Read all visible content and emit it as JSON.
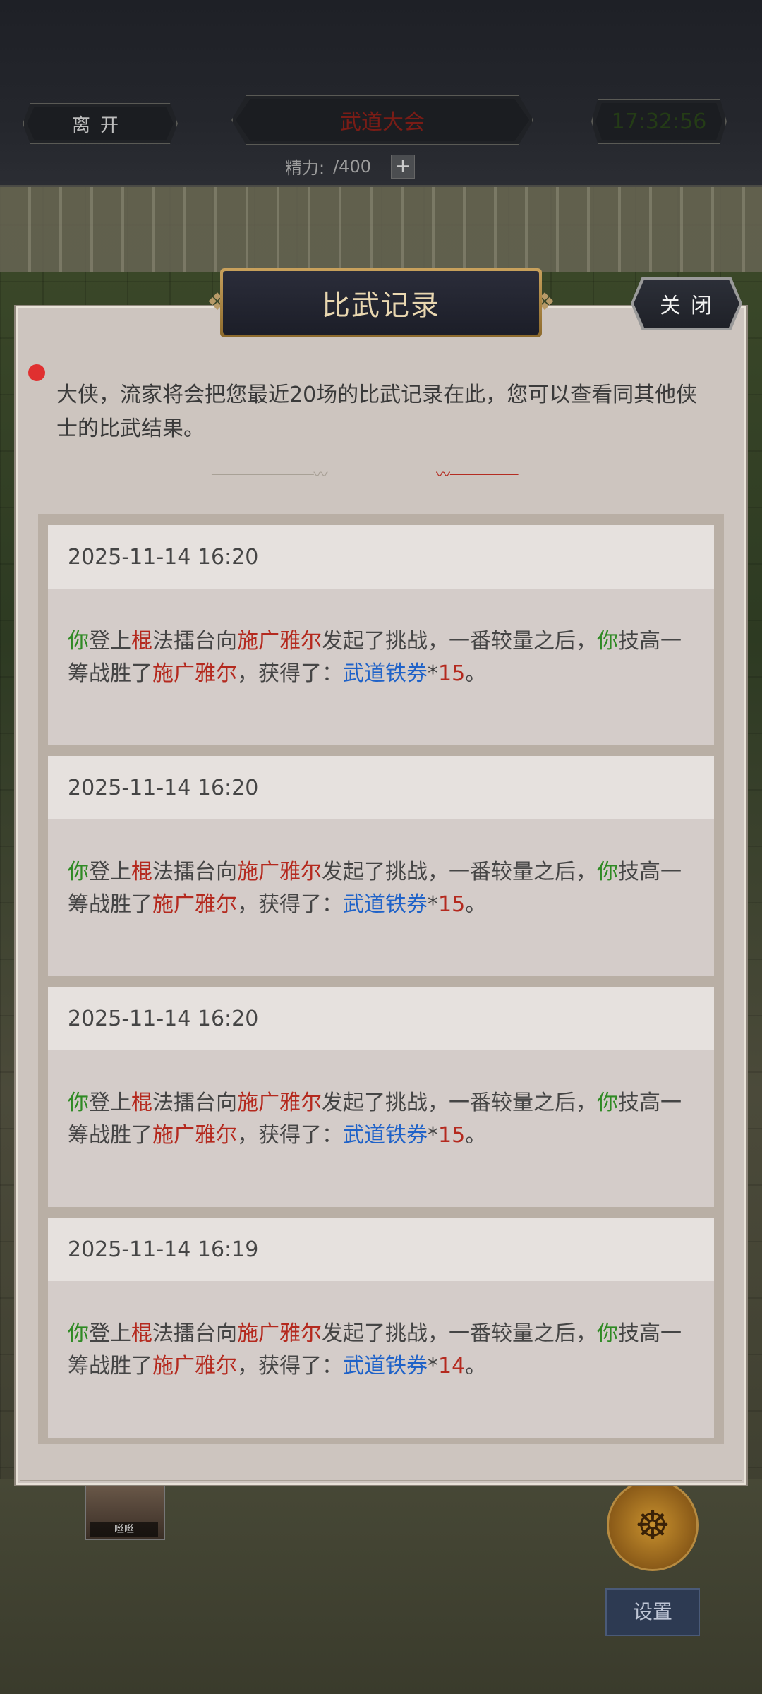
{
  "top_bar": {
    "leave_label": "离开",
    "event_title": "武道大会",
    "clock": "17:32:56",
    "energy_label": "精力:",
    "energy_current": "",
    "energy_max": "/400",
    "energy_add": "+"
  },
  "modal": {
    "title": "比武记录",
    "close_label": "关闭",
    "intro": "大侠，流家将会把您最近20场的比武记录在此，您可以查看同其他侠士的比武结果。",
    "records": [
      {
        "time": "2025-11-14 16:20",
        "you": "你",
        "t1": "登上",
        "weapon": "棍",
        "t2": "法擂台向",
        "opponent": "施广雅尔",
        "t3": "发起了挑战，一番较量之后，",
        "you2": "你",
        "t4": "技高一筹战胜了",
        "opponent2": "施广雅尔",
        "t5": "，获得了：",
        "reward": "武道铁券",
        "star": "*",
        "qty": "15",
        "end": "。"
      },
      {
        "time": "2025-11-14 16:20",
        "you": "你",
        "t1": "登上",
        "weapon": "棍",
        "t2": "法擂台向",
        "opponent": "施广雅尔",
        "t3": "发起了挑战，一番较量之后，",
        "you2": "你",
        "t4": "技高一筹战胜了",
        "opponent2": "施广雅尔",
        "t5": "，获得了：",
        "reward": "武道铁券",
        "star": "*",
        "qty": "15",
        "end": "。"
      },
      {
        "time": "2025-11-14 16:20",
        "you": "你",
        "t1": "登上",
        "weapon": "棍",
        "t2": "法擂台向",
        "opponent": "施广雅尔",
        "t3": "发起了挑战，一番较量之后，",
        "you2": "你",
        "t4": "技高一筹战胜了",
        "opponent2": "施广雅尔",
        "t5": "，获得了：",
        "reward": "武道铁券",
        "star": "*",
        "qty": "15",
        "end": "。"
      },
      {
        "time": "2025-11-14 16:19",
        "you": "你",
        "t1": "登上",
        "weapon": "棍",
        "t2": "法擂台向",
        "opponent": "施广雅尔",
        "t3": "发起了挑战，一番较量之后，",
        "you2": "你",
        "t4": "技高一筹战胜了",
        "opponent2": "施广雅尔",
        "t5": "，获得了：",
        "reward": "武道铁券",
        "star": "*",
        "qty": "14",
        "end": "。"
      }
    ]
  },
  "scene": {
    "character_name": "咝咝",
    "settings_label": "设置",
    "meditate_icon": "meditate-icon"
  },
  "colors": {
    "you": "#2f8a24",
    "opponent": "#b4291e",
    "reward": "#1f62c8"
  }
}
